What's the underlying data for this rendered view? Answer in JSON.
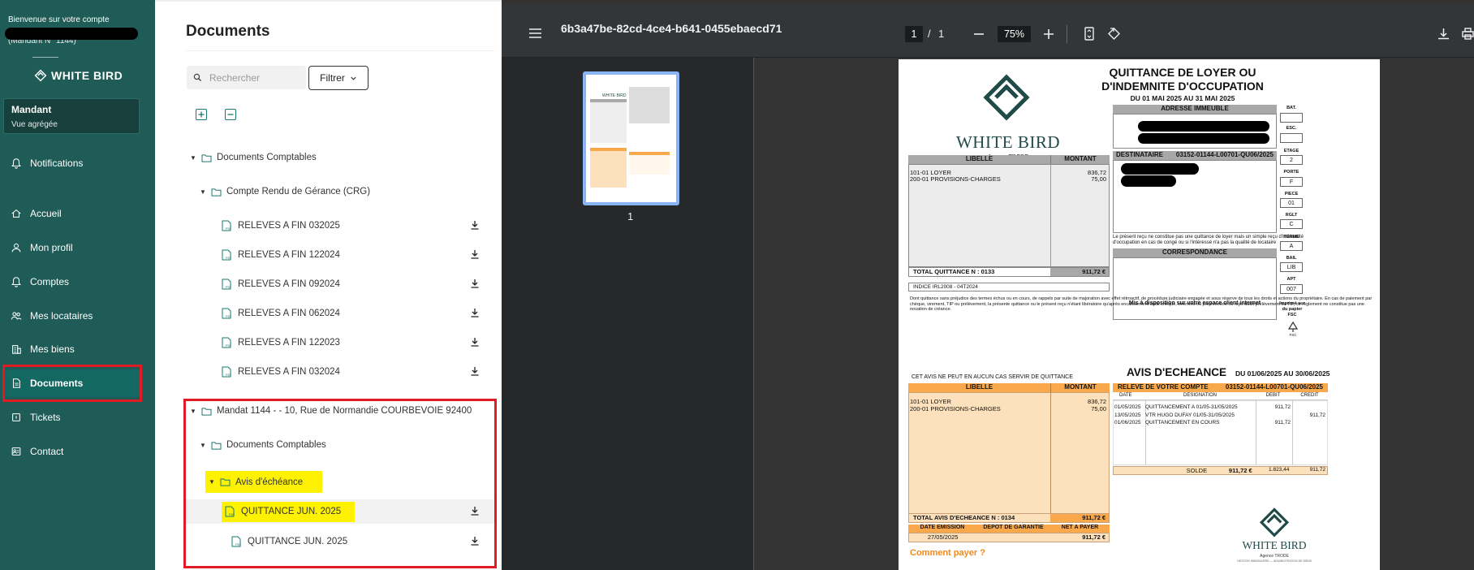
{
  "sidebar": {
    "welcome": "Bienvenue sur votre compte",
    "mandant_number": "(Mandant N° 1144)",
    "logo_text": "WHITE BIRD",
    "card_title": "Mandant",
    "card_subtitle": "Vue agrégée",
    "nav": [
      {
        "label": "Notifications",
        "icon": "bell-icon"
      },
      {
        "label": "Accueil",
        "icon": "home-icon"
      },
      {
        "label": "Mon profil",
        "icon": "user-icon"
      },
      {
        "label": "Comptes",
        "icon": "bell-icon"
      },
      {
        "label": "Mes locataires",
        "icon": "users-icon"
      },
      {
        "label": "Mes biens",
        "icon": "building-icon"
      },
      {
        "label": "Documents",
        "icon": "document-icon",
        "active": true
      },
      {
        "label": "Tickets",
        "icon": "ticket-icon"
      },
      {
        "label": "Contact",
        "icon": "contact-icon"
      }
    ]
  },
  "documents": {
    "title": "Documents",
    "search_placeholder": "Rechercher",
    "filter_label": "Filtrer",
    "tree": {
      "folder_comptables": "Documents Comptables",
      "folder_crg": "Compte Rendu de Gérance (CRG)",
      "crg_files": [
        "RELEVES A FIN 032025",
        "RELEVES A FIN 122024",
        "RELEVES A FIN 092024",
        "RELEVES A FIN 062024",
        "RELEVES A FIN 122023",
        "RELEVES A FIN 032024"
      ],
      "mandat_folder": "Mandat 1144 - - 10, Rue de Normandie COURBEVOIE 92400",
      "mandat_sub": "Documents Comptables",
      "avis_folder": "Avis d'échéance",
      "avis_files": [
        "QUITTANCE JUN. 2025",
        "QUITTANCE JUN. 2025"
      ]
    }
  },
  "viewer": {
    "filename": "6b3a47be-82cd-4ce4-b641-0455ebaecd71",
    "page_current": "1",
    "page_sep": "/",
    "page_total": "1",
    "zoom": "75%",
    "thumb_label": "1"
  },
  "pdf": {
    "title1": "QUITTANCE DE LOYER OU",
    "title2": "D'INDEMNITE D'OCCUPATION",
    "period": "DU 01 MAI 2025 AU 31 MAI 2025",
    "brand": "WHITE BIRD",
    "agency": "Agence TRODE",
    "brand_tag": "GESTION IMMOBILIÈRE — ADMINISTRATION DE BIENS",
    "adresse_header": "ADRESSE IMMEUBLE",
    "bat": "BAT.",
    "esc": "ESC.",
    "etage_label": "ETAGE",
    "etage": "2",
    "porte_label": "PORTE",
    "porte": "F",
    "piece_label": "PIECE",
    "piece": "01",
    "rglt_label": "RGLT",
    "rglt": "C",
    "terme_label": "TERME",
    "terme": "A",
    "bail_label": "BAIL",
    "bail": "LIB",
    "apt_label": "APT",
    "apt": "007",
    "imprime": "Imprimé sur du papier FSC",
    "fsc": "FSC",
    "destinataire_label": "DESTINATAIRE",
    "destinataire_ref": "03152-01144-L00701-QU06/2025",
    "libelle": "LIBELLE",
    "montant": "MONTANT",
    "line1": "101-01 LOYER",
    "line1_val": "836,72",
    "line2": "200-01 PROVISIONS-CHARGES",
    "line2_val": "75,00",
    "note_recu": "Le présent reçu ne constitue pas une quittance de loyer mais un simple reçu d'indemnité d'occupation en cas de congé ou si l'intéressé n'a pas la qualité de locataire",
    "correspondance": "CORRESPONDANCE",
    "mis_dispo": "Mis à disposition sur votre espace client internet",
    "total_quittance": "TOTAL QUITTANCE N : 0133",
    "total_quittance_val": "911,72 €",
    "indice": "INDICE IRL2008 - 04T2024",
    "legal": "Dont quittance sans préjudice des termes échus ou en cours, de rappels par suite de majoration avec effet rétroactif, de procédure judiciaire engagée et sous réserve de tous les droits et actions du propriétaire. En cas de paiement par chèque, virement, TIP ou prélèvement, la présente quittance ou le présent reçu n'étant libératoire qu'après encaissement dudit chèque, virement ou prélèvement ou rejet dudit prélèvement ou TIP, ce règlement ne constitue pas une novation de créance.",
    "avis_warning": "CET AVIS NE PEUT EN AUCUN CAS SERVIR DE QUITTANCE",
    "avis_title": "AVIS D'ECHEANCE",
    "avis_period": "DU 01/06/2025 AU 30/06/2025",
    "releve": "RELEVE DE VOTRE COMPTE",
    "releve_ref": "03152-01144-L00701-QU06/2025",
    "cols": [
      "DATE",
      "DESIGNATION",
      "DEBIT",
      "CREDIT"
    ],
    "rows": [
      {
        "date": "01/05/2025",
        "designation": "QUITTANCEMENT A 01/05-31/05/2025",
        "debit": "911,72",
        "credit": ""
      },
      {
        "date": "13/05/2025",
        "designation": "VTR HUGO DUFAY 01/05-31/05/2025",
        "debit": "",
        "credit": "911,72"
      },
      {
        "date": "01/06/2025",
        "designation": "QUITTANCEMENT EN COURS",
        "debit": "911,72",
        "credit": ""
      }
    ],
    "solde": "SOLDE",
    "solde_val": "911,72 €",
    "solde_debit": "1.823,44",
    "solde_credit": "911,72",
    "total_avis": "TOTAL AVIS D'ECHEANCE N : 0134",
    "total_avis_val": "911,72 €",
    "date_emission": "DATE EMISSION",
    "depot": "DEPOT DE GARANTIE",
    "net_payer": "NET A PAYER",
    "date_emission_val": "27/05/2025",
    "net_payer_val": "911,72 €",
    "comment_payer": "Comment payer ?"
  }
}
